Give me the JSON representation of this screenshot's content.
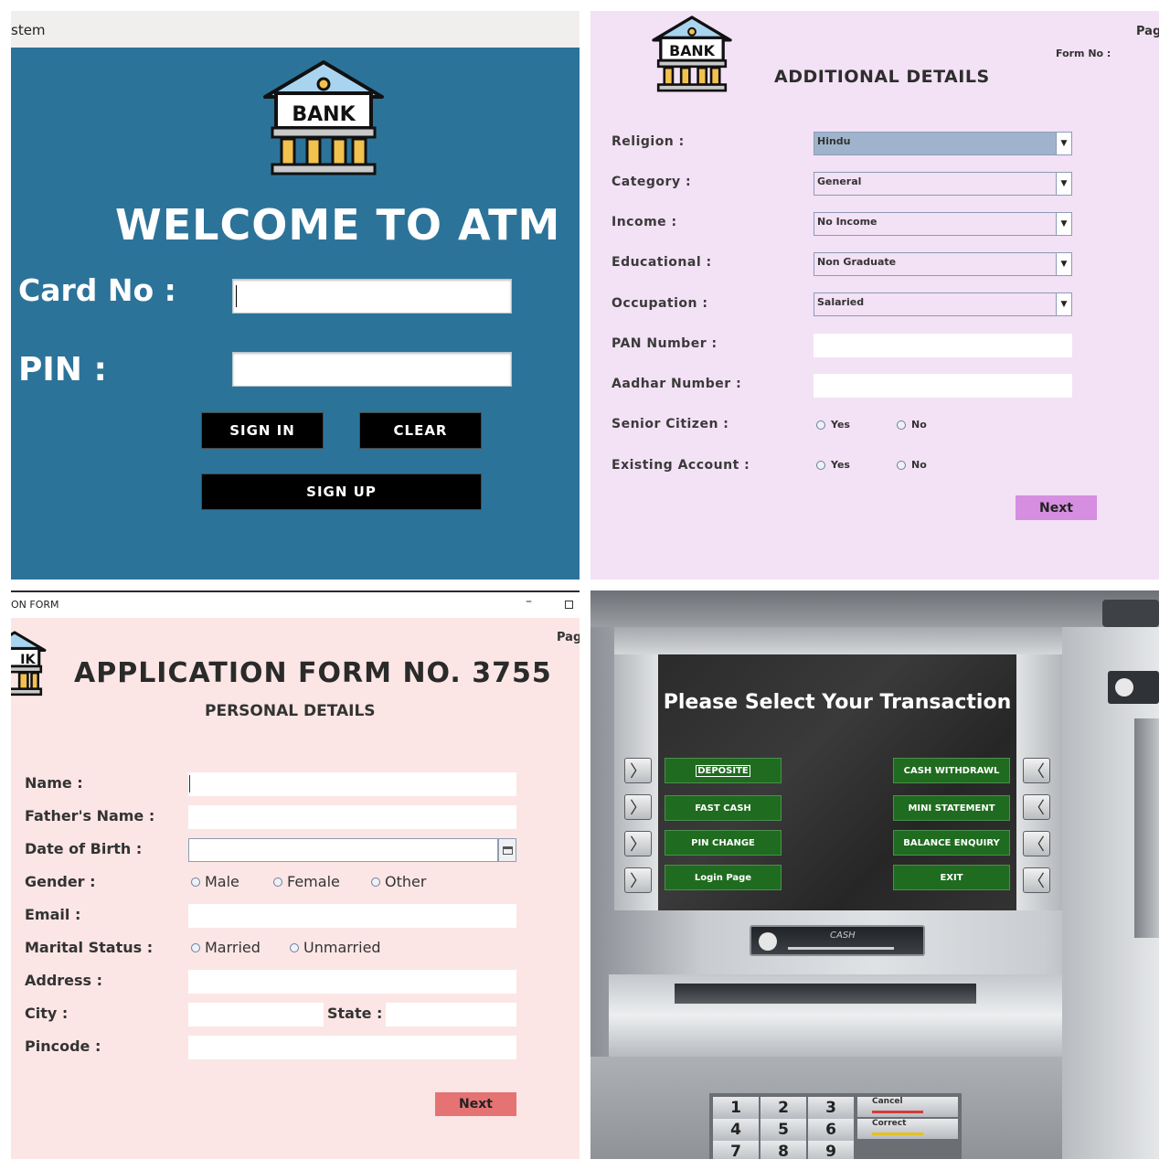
{
  "login": {
    "window_title": "stem",
    "welcome": "WELCOME TO ATM",
    "logo_text": "BANK",
    "card_label": "Card No :",
    "pin_label": "PIN :",
    "card_value": "",
    "pin_value": "",
    "sign_in": "SIGN IN",
    "clear": "CLEAR",
    "sign_up": "SIGN UP",
    "colors": {
      "background": "#2c7399",
      "button": "#000000"
    }
  },
  "additional": {
    "page_label": "Pag",
    "form_no_label": "Form No :",
    "logo_text": "BANK",
    "title": "ADDITIONAL DETAILS",
    "religion_label": "Religion :",
    "religion_value": "Hindu",
    "category_label": "Category :",
    "category_value": "General",
    "income_label": "Income :",
    "income_value": "No Income",
    "education_label": "Educational :",
    "education_value": "Non Graduate",
    "occupation_label": "Occupation :",
    "occupation_value": "Salaried",
    "pan_label": "PAN Number :",
    "aadhar_label": "Aadhar Number :",
    "senior_label": "Senior Citizen :",
    "existing_label": "Existing Account :",
    "yes": "Yes",
    "no": "No",
    "next": "Next",
    "colors": {
      "background": "#f3e1f5",
      "selected": "#9fb4cc",
      "next_button": "#d58ee0"
    }
  },
  "application": {
    "window_title": "ON FORM",
    "page_label": "Pag",
    "logo_text": "IK",
    "title": "APPLICATION FORM NO. 3755",
    "subtitle": "PERSONAL DETAILS",
    "name_label": "Name :",
    "father_label": "Father's Name :",
    "dob_label": "Date of Birth :",
    "gender_label": "Gender :",
    "male": "Male",
    "female": "Female",
    "other": "Other",
    "email_label": "Email :",
    "marital_label": "Marital Status :",
    "married": "Married",
    "unmarried": "Unmarried",
    "address_label": "Address :",
    "city_label": "City :",
    "state_label": "State :",
    "pincode_label": "Pincode :",
    "next": "Next",
    "colors": {
      "background": "#fbe6e5",
      "next_button": "#e57373"
    }
  },
  "atm": {
    "title": "Please Select Your Transaction",
    "deposit": "DEPOSITE",
    "cash_withdrawal": "CASH WITHDRAWL",
    "fast_cash": "FAST CASH",
    "mini_statement": "MINI STATEMENT",
    "pin_change": "PIN CHANGE",
    "balance_enquiry": "BALANCE ENQUIRY",
    "login_page": "Login Page",
    "exit": "EXIT",
    "card_slot_label": "CASH",
    "keypad": [
      "1",
      "2",
      "3",
      "4",
      "5",
      "6",
      "7",
      "8",
      "9"
    ],
    "cancel_key": "Cancel",
    "correct_key": "Correct",
    "colors": {
      "button": "#1f6b1f",
      "screen": "#2b2b2b"
    }
  }
}
